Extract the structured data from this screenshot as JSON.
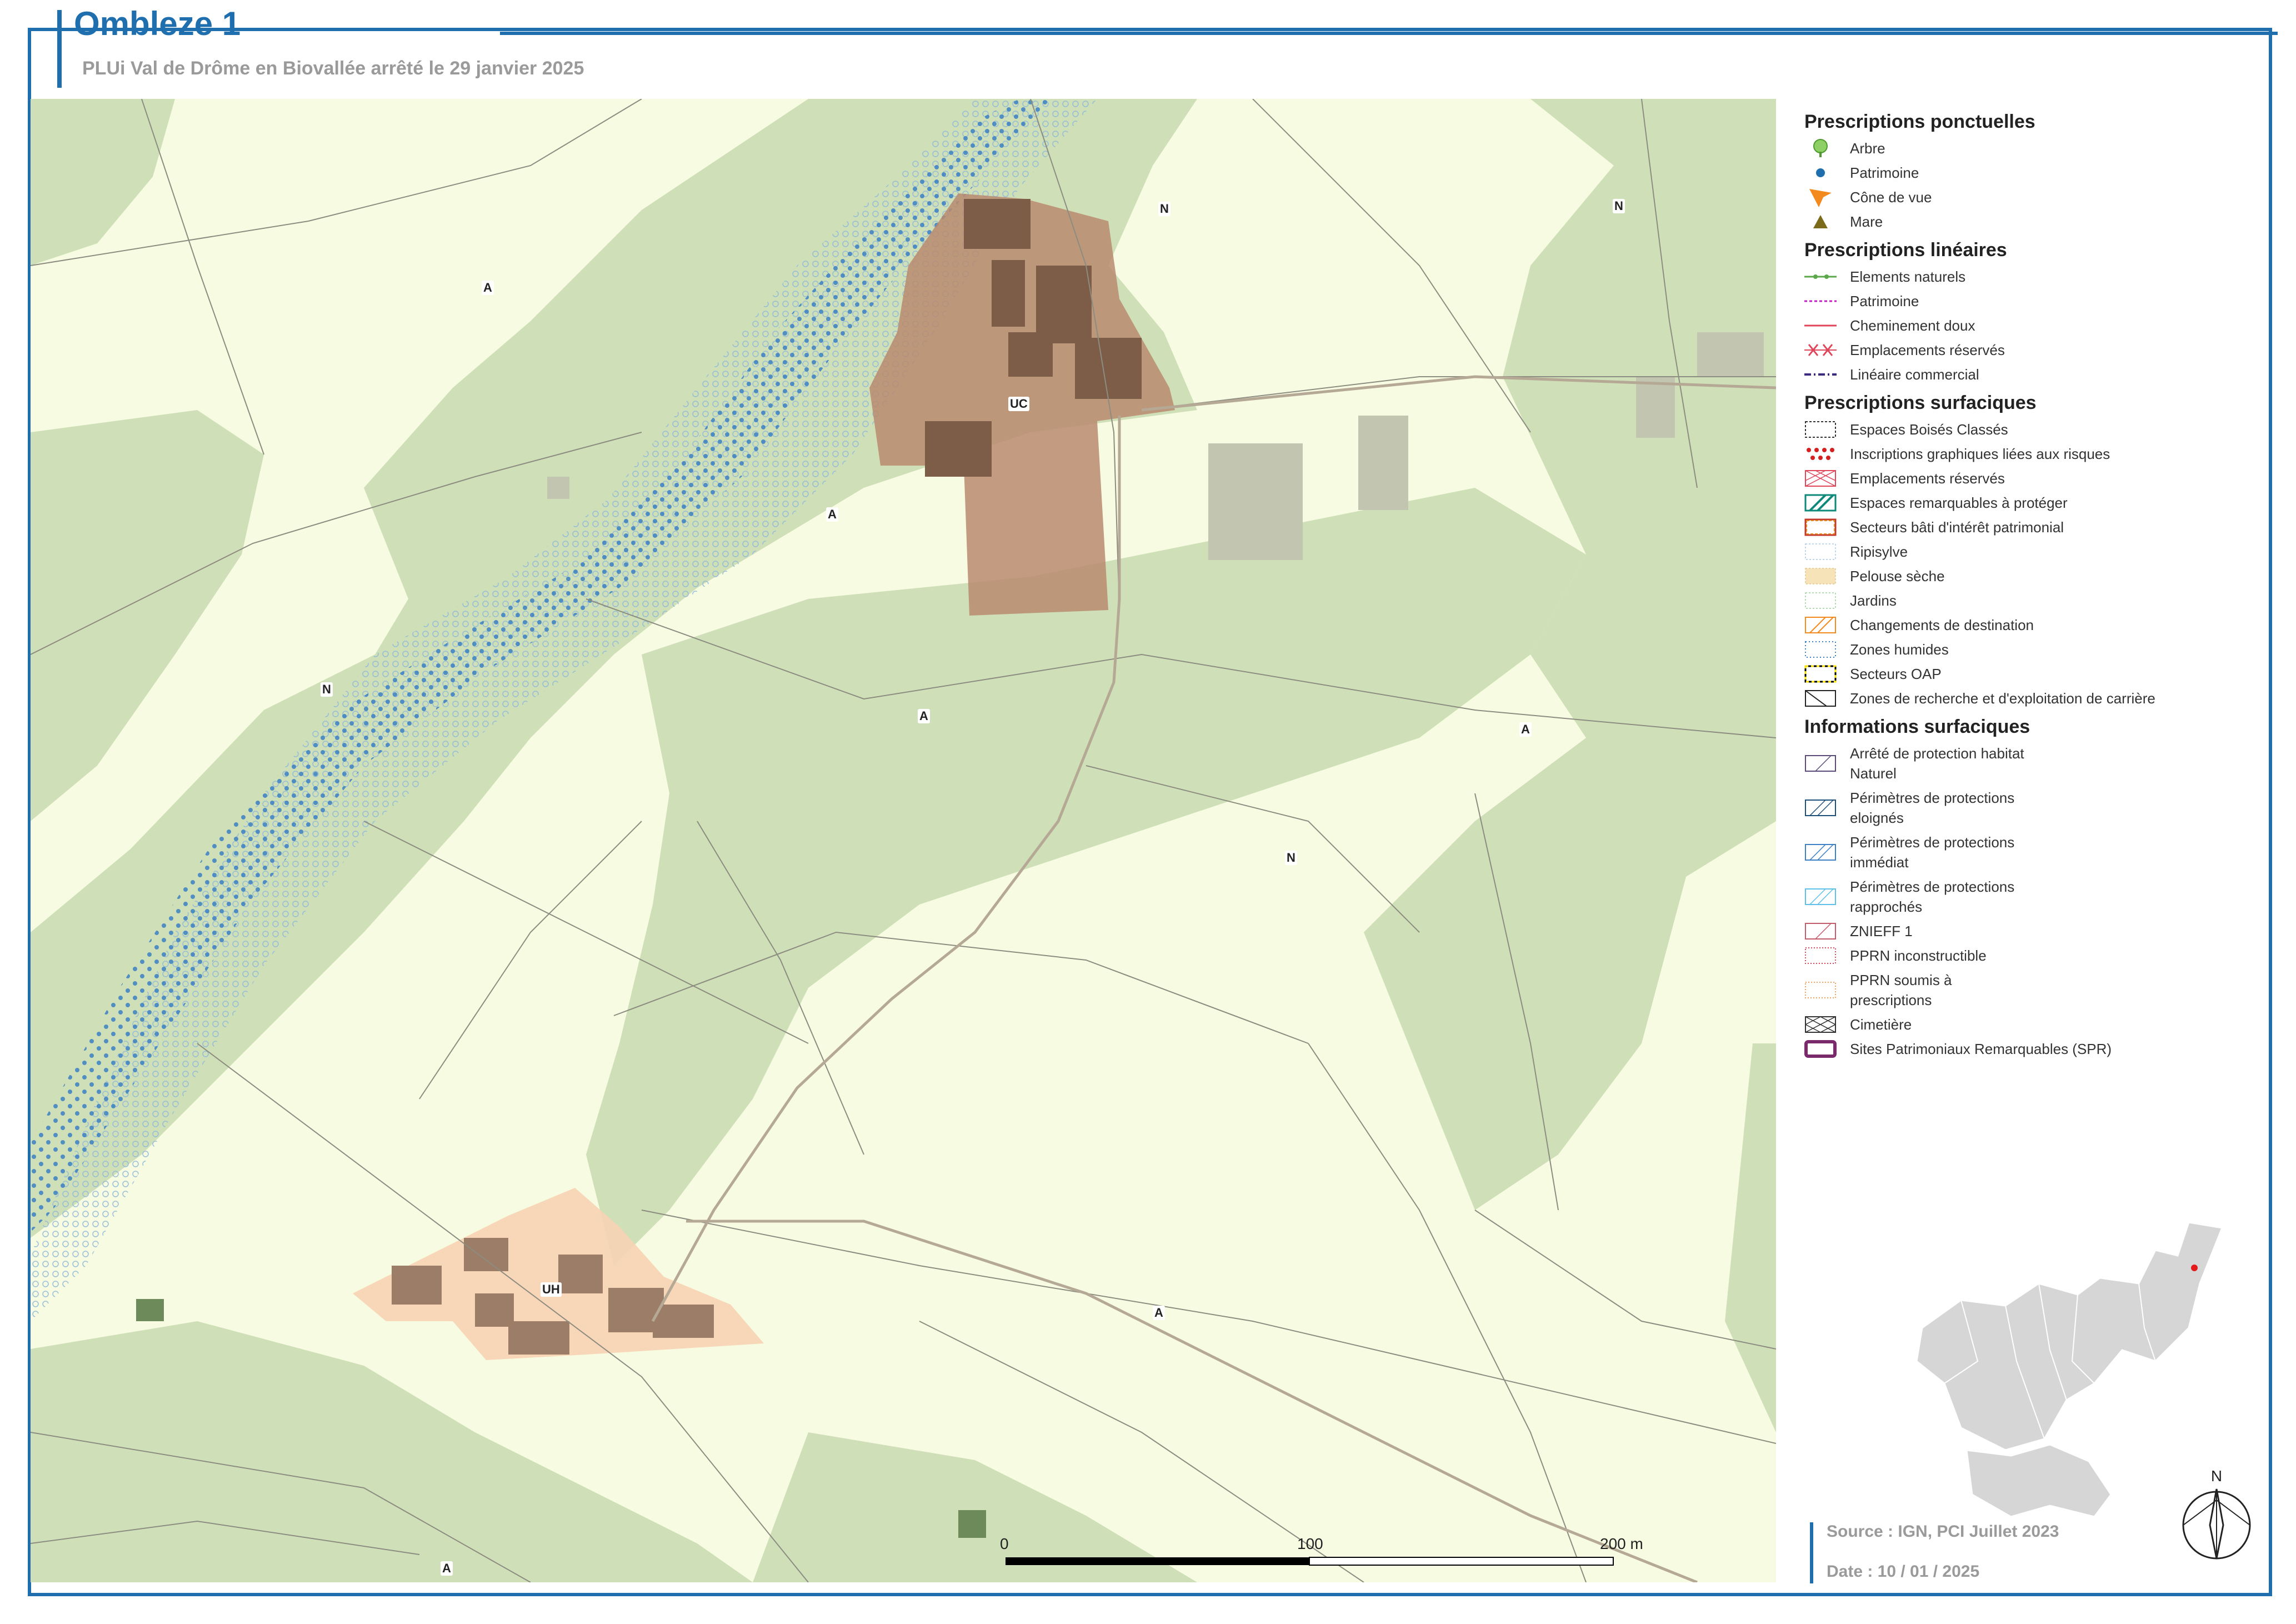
{
  "header": {
    "title": "Ombleze 1",
    "subtitle": "PLUi Val de Drôme en Biovallée arrêté le 29 janvier 2025"
  },
  "map": {
    "zone_labels": [
      "A",
      "N",
      "N",
      "UC",
      "A",
      "N",
      "A",
      "A",
      "N",
      "UH",
      "A",
      "A"
    ],
    "scale": {
      "labels": [
        "0",
        "100",
        "200 m"
      ]
    }
  },
  "legend": {
    "sections": [
      {
        "title": "Prescriptions ponctuelles",
        "items": [
          {
            "label": "Arbre",
            "symbol": "tree-icon"
          },
          {
            "label": "Patrimoine",
            "symbol": "point-blue"
          },
          {
            "label": "Cône de vue",
            "symbol": "view-cone-icon"
          },
          {
            "label": "Mare",
            "symbol": "triangle-olive"
          }
        ]
      },
      {
        "title": "Prescriptions linéaires",
        "items": [
          {
            "label": "Elements naturels",
            "symbol": "line-green-dots"
          },
          {
            "label": "Patrimoine",
            "symbol": "line-magenta-dash"
          },
          {
            "label": "Cheminement doux",
            "symbol": "line-red"
          },
          {
            "label": "Emplacements réservés",
            "symbol": "line-red-cross"
          },
          {
            "label": "Linéaire commercial",
            "symbol": "line-purple-dash"
          }
        ]
      },
      {
        "title": "Prescriptions surfaciques",
        "items": [
          {
            "label": "Espaces Boisés Classés",
            "symbol": "box-dash-black"
          },
          {
            "label": "Inscriptions graphiques liées aux risques",
            "symbol": "box-red-dots"
          },
          {
            "label": "Emplacements réservés",
            "symbol": "box-red-cross"
          },
          {
            "label": "Espaces remarquables à protéger",
            "symbol": "box-teal-hatch"
          },
          {
            "label": "Secteurs bâti d'intérêt patrimonial",
            "symbol": "box-orange-dash"
          },
          {
            "label": "Ripisylve",
            "symbol": "box-blue-dots-light"
          },
          {
            "label": "Pelouse sèche",
            "symbol": "box-beige-dots"
          },
          {
            "label": "Jardins",
            "symbol": "box-green-dots"
          },
          {
            "label": "Changements de destination",
            "symbol": "box-orange-hatch"
          },
          {
            "label": "Zones humides",
            "symbol": "box-blue-dots"
          },
          {
            "label": "Secteurs OAP",
            "symbol": "box-yellow-dash"
          },
          {
            "label": "Zones de recherche et d'exploitation de carrière",
            "symbol": "box-black-diag"
          }
        ]
      },
      {
        "title": "Informations surfaciques",
        "items": [
          {
            "label": "Arrêté de protection habitat Naturel",
            "symbol": "box-purple-hatch"
          },
          {
            "label": "Périmètres de protections eloignés",
            "symbol": "box-navy-hatch"
          },
          {
            "label": "Périmètres de protections immédiat",
            "symbol": "box-blue-hatch"
          },
          {
            "label": "Périmètres de protections rapprochés",
            "symbol": "box-cyan-hatch"
          },
          {
            "label": "ZNIEFF 1",
            "symbol": "box-rose-hatch"
          },
          {
            "label": "PPRN inconstructible",
            "symbol": "box-pink-dots"
          },
          {
            "label": "PPRN soumis à prescriptions",
            "symbol": "box-orange-dots"
          },
          {
            "label": "Cimetière",
            "symbol": "box-cross-hatch"
          },
          {
            "label": "Sites Patrimoniaux Remarquables (SPR)",
            "symbol": "box-purple-thick"
          }
        ]
      }
    ]
  },
  "north_arrow": {
    "label": "N"
  },
  "footer": {
    "source": "Source : IGN, PCI Juillet 2023",
    "date": "Date : 10 / 01 / 2025"
  },
  "colors": {
    "frame": "#1f6fae",
    "agricultural": "#f7fbe1",
    "forest": "#cfe0b8",
    "uc_zone": "#b98a6e",
    "uh_zone": "#f6d3b4",
    "building": "#8a6a55",
    "riparian_dots": "#3b7fc4"
  }
}
